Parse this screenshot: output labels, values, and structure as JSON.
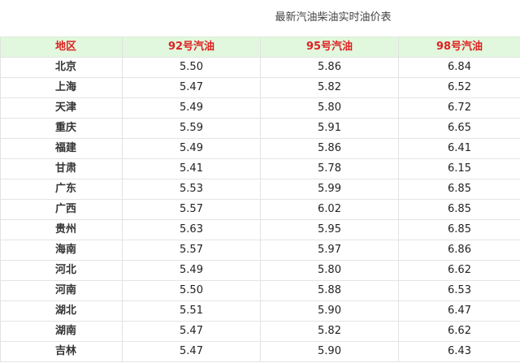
{
  "page": {
    "title": "最新汽油柴油实时油价表"
  },
  "table": {
    "headers": [
      "地区",
      "92号汽油",
      "95号汽油",
      "98号汽油"
    ],
    "rows": [
      [
        "北京",
        "5.50",
        "5.86",
        "6.84"
      ],
      [
        "上海",
        "5.47",
        "5.82",
        "6.52"
      ],
      [
        "天津",
        "5.49",
        "5.80",
        "6.72"
      ],
      [
        "重庆",
        "5.59",
        "5.91",
        "6.65"
      ],
      [
        "福建",
        "5.49",
        "5.86",
        "6.41"
      ],
      [
        "甘肃",
        "5.41",
        "5.78",
        "6.15"
      ],
      [
        "广东",
        "5.53",
        "5.99",
        "6.85"
      ],
      [
        "广西",
        "5.57",
        "6.02",
        "6.85"
      ],
      [
        "贵州",
        "5.63",
        "5.95",
        "6.85"
      ],
      [
        "海南",
        "5.57",
        "5.97",
        "6.86"
      ],
      [
        "河北",
        "5.49",
        "5.80",
        "6.62"
      ],
      [
        "河南",
        "5.50",
        "5.88",
        "6.53"
      ],
      [
        "湖北",
        "5.51",
        "5.90",
        "6.47"
      ],
      [
        "湖南",
        "5.47",
        "5.82",
        "6.62"
      ],
      [
        "吉林",
        "5.47",
        "5.90",
        "6.43"
      ]
    ]
  },
  "colors": {
    "header_background": "#e2f8de",
    "header_text": "#dd2222",
    "body_text": "#222222",
    "grid": "#e2e2e2"
  }
}
